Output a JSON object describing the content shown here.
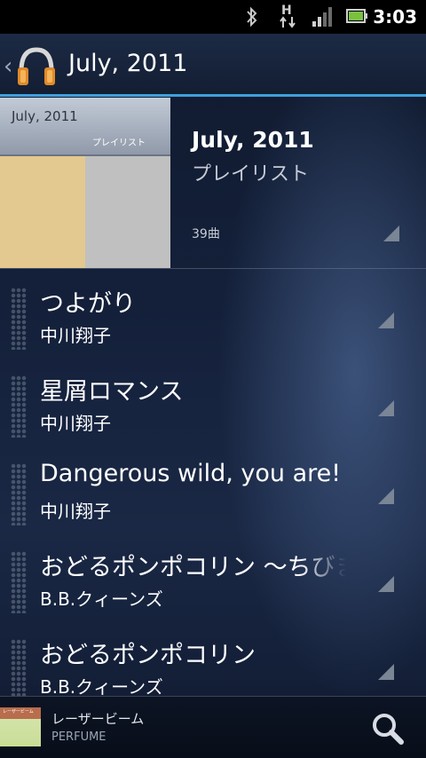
{
  "status_bar": {
    "time": "3:03",
    "network_type": "H",
    "icons": [
      "bluetooth-icon",
      "data-activity-icon",
      "signal-icon",
      "battery-icon"
    ]
  },
  "header": {
    "title": "July, 2011",
    "back_icon": "chevron-left-icon",
    "app_icon": "headphones-icon"
  },
  "playlist": {
    "art_title": "July, 2011",
    "art_subtitle": "プレイリスト",
    "title": "July, 2011",
    "subtitle": "プレイリスト",
    "count": "39曲"
  },
  "tracks": [
    {
      "title": "つよがり",
      "artist": "中川翔子"
    },
    {
      "title": "星屑ロマンス",
      "artist": "中川翔子"
    },
    {
      "title": "Dangerous wild, you are!",
      "artist": "中川翔子"
    },
    {
      "title": "おどるポンポコリン 〜ちびまる",
      "artist": "B.B.クィーンズ"
    },
    {
      "title": "おどるポンポコリン",
      "artist": "B.B.クィーンズ"
    }
  ],
  "now_playing": {
    "thumb_text": "レーザービーム",
    "title": "レーザービーム",
    "artist": "PERFUME",
    "search_icon": "search-icon"
  },
  "colors": {
    "accent": "#3fa0dc",
    "background": "#101a2e",
    "art_tan": "#e3c88f",
    "art_gray": "#c0c0c0"
  }
}
